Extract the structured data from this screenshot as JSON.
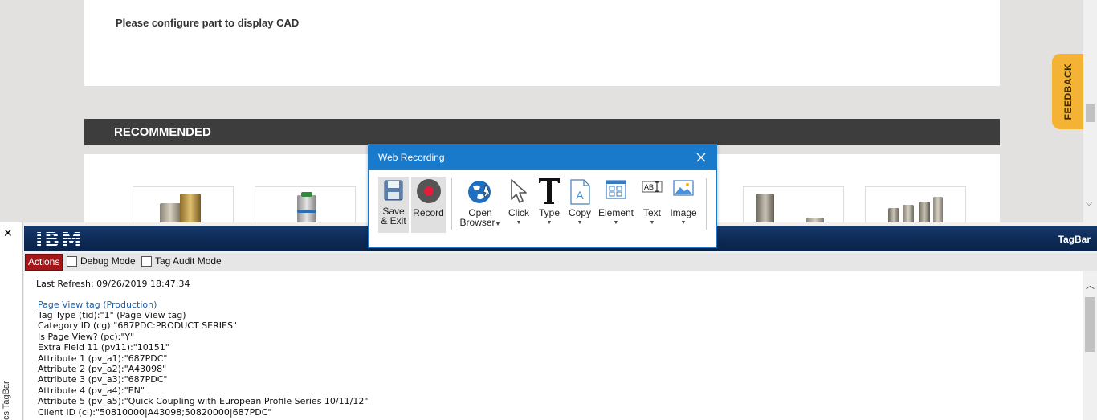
{
  "page": {
    "cad_message": "Please configure part to display CAD",
    "recommended_title": "RECOMMENDED",
    "feedback_label": "FEEDBACK"
  },
  "dialog": {
    "title": "Web Recording",
    "tools": [
      {
        "label": "Save",
        "label2": "& Exit",
        "icon": "save-icon"
      },
      {
        "label": "Record",
        "icon": "record-icon"
      },
      {
        "label": "Open",
        "label2": "Browser",
        "icon": "globe-icon"
      },
      {
        "label": "Click",
        "icon": "cursor-icon"
      },
      {
        "label": "Type",
        "icon": "type-icon"
      },
      {
        "label": "Copy",
        "icon": "copy-icon"
      },
      {
        "label": "Element",
        "icon": "element-icon"
      },
      {
        "label": "Text",
        "icon": "text-icon"
      },
      {
        "label": "Image",
        "icon": "image-icon"
      }
    ]
  },
  "tagbar": {
    "close_symbol": "✕",
    "side_label": "cs TagBar",
    "logo": "IBM",
    "title": "TagBar",
    "actions_label": "Actions",
    "debug_label": "Debug Mode",
    "audit_label": "Tag Audit Mode",
    "last_refresh": "Last Refresh: 09/26/2019 18:47:34",
    "tag_title": "Page View tag (Production)",
    "lines": [
      "Tag Type (tid):\"1\" (Page View tag)",
      "Category ID (cg):\"687PDC:PRODUCT SERIES\"",
      "Is Page View? (pc):\"Y\"",
      "Extra Field 11 (pv11):\"10151\"",
      "Attribute 1 (pv_a1):\"687PDC\"",
      "Attribute 2 (pv_a2):\"A43098\"",
      "Attribute 3 (pv_a3):\"687PDC\"",
      "Attribute 4 (pv_a4):\"EN\"",
      "Attribute 5 (pv_a5):\"Quick Coupling with European Profile Series 10/11/12\"",
      "Client ID (ci):\"50810000|A43098;50820000|687PDC\""
    ]
  }
}
